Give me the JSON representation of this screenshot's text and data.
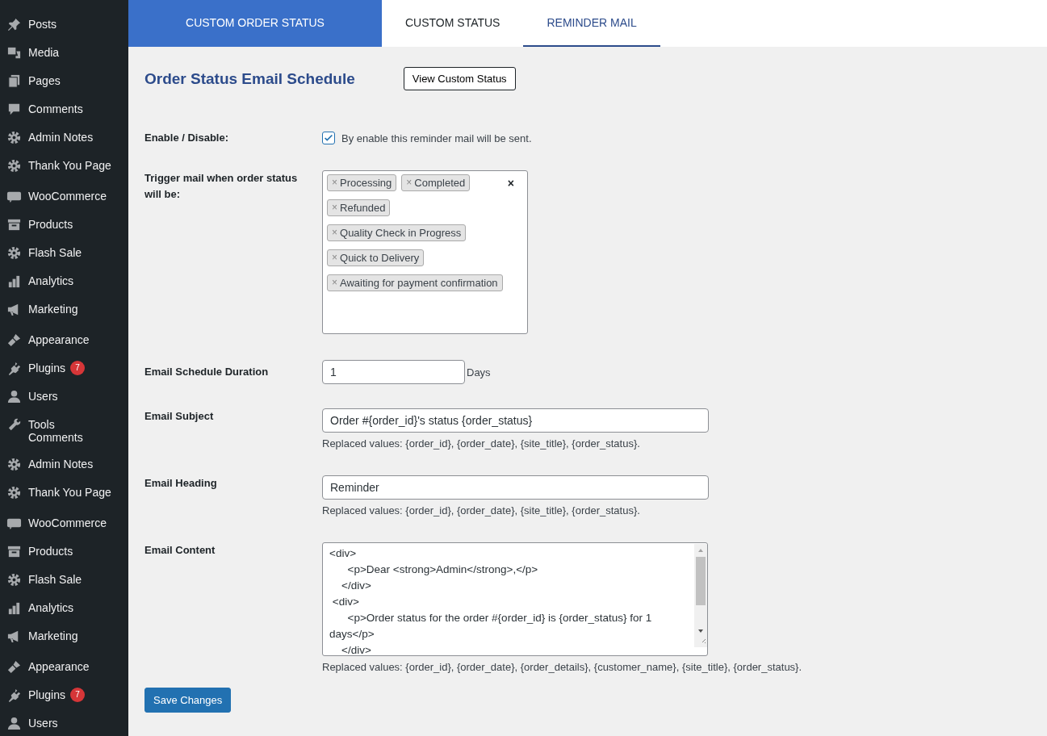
{
  "sidebar": {
    "items": [
      {
        "label": "Posts"
      },
      {
        "label": "Media"
      },
      {
        "label": "Pages"
      },
      {
        "label": "Comments"
      },
      {
        "label": "Admin Notes"
      },
      {
        "label": "Thank You Page"
      },
      {
        "label": "WooCommerce"
      },
      {
        "label": "Products"
      },
      {
        "label": "Flash Sale"
      },
      {
        "label": "Analytics"
      },
      {
        "label": "Marketing"
      },
      {
        "label": "Appearance"
      },
      {
        "label": "Plugins",
        "badge": "7"
      },
      {
        "label": "Users"
      },
      {
        "label": "Tools",
        "sublabel": "Comments"
      },
      {
        "label": "Admin Notes"
      },
      {
        "label": "Thank You Page"
      },
      {
        "label": "WooCommerce"
      },
      {
        "label": "Products"
      },
      {
        "label": "Flash Sale"
      },
      {
        "label": "Analytics"
      },
      {
        "label": "Marketing"
      },
      {
        "label": "Appearance"
      },
      {
        "label": "Plugins",
        "badge": "7"
      },
      {
        "label": "Users"
      }
    ]
  },
  "tabs": [
    {
      "label": "CUSTOM ORDER STATUS",
      "kind": "main",
      "selected": false
    },
    {
      "label": "CUSTOM STATUS",
      "kind": "plain",
      "selected": false
    },
    {
      "label": "REMINDER MAIL",
      "kind": "plain",
      "selected": true
    }
  ],
  "page": {
    "title": "Order Status Email Schedule",
    "view_button": "View Custom Status"
  },
  "form": {
    "enable": {
      "label": "Enable / Disable:",
      "checked": true,
      "text": "By enable this reminder mail will be sent."
    },
    "trigger": {
      "label": "Trigger mail when order status will be:",
      "clear": "×",
      "tags": [
        {
          "remove": "×",
          "label": "Processing"
        },
        {
          "remove": "×",
          "label": "Completed"
        },
        {
          "remove": "×",
          "label": "Refunded"
        },
        {
          "remove": "×",
          "label": "Quality Check in Progress"
        },
        {
          "remove": "×",
          "label": "Quick to Delivery"
        },
        {
          "remove": "×",
          "label": "Awaiting for payment confirmation"
        }
      ]
    },
    "duration": {
      "label": "Email Schedule Duration",
      "value": "1",
      "unit": "Days"
    },
    "subject": {
      "label": "Email Subject",
      "value": "Order #{order_id}'s status {order_status}",
      "hint": "Replaced values: {order_id}, {order_date}, {site_title}, {order_status}."
    },
    "heading": {
      "label": "Email Heading",
      "value": "Reminder",
      "hint": "Replaced values: {order_id}, {order_date}, {site_title}, {order_status}."
    },
    "content": {
      "label": "Email Content",
      "value": "<div>\n      <p>Dear <strong>Admin</strong>,</p>\n    </div>\n <div>\n      <p>Order status for the order #{order_id} is {order_status} for 1 days</p>\n    </div>",
      "hint": "Replaced values: {order_id}, {order_date}, {order_details}, {customer_name}, {site_title}, {order_status}."
    }
  },
  "save_button": "Save Changes"
}
